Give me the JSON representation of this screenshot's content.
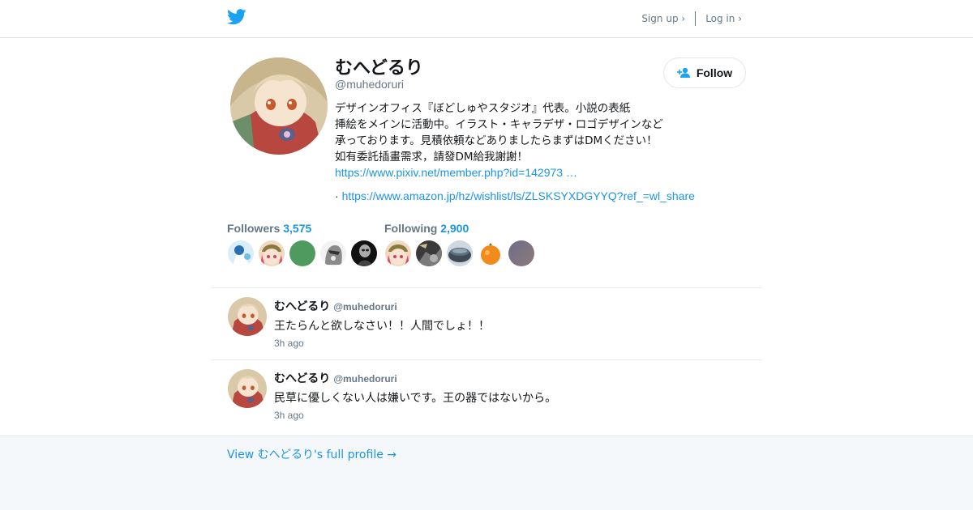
{
  "header": {
    "logo_icon": "twitter-bird-icon",
    "signup_label": "Sign up ›",
    "login_label": "Log in ›"
  },
  "profile": {
    "name": "むへどるり",
    "handle": "@muhedoruri",
    "follow_label": "Follow",
    "bio_lines": [
      "デザインオフィス『ぼどしゅやスタジオ』代表。小説の表紙",
      "挿絵をメインに活動中。イラスト・キャラデザ・ロゴデザインなど",
      "承っております。見積依頼などありましたらまずはDMください！",
      "如有委託插畫需求，請發DM給我謝謝！"
    ],
    "link1": "https://www.pixiv.net/member.php?id=142973 …",
    "link2_prefix": "·",
    "link2": "https://www.amazon.jp/hz/wishlist/ls/ZLSKSYXDGYYQ?ref_=wl_share"
  },
  "stats": {
    "followers_label": "Followers",
    "followers_count": "3,575",
    "following_label": "Following",
    "following_count": "2,900"
  },
  "tweets": [
    {
      "name": "むへどるり",
      "handle": "@muhedoruri",
      "text": "王たらんと欲しなさい！！人間でしょ！！",
      "time": "3h ago"
    },
    {
      "name": "むへどるり",
      "handle": "@muhedoruri",
      "text": "民草に優しくない人は嫌いです。王の器ではないから。",
      "time": "3h ago"
    }
  ],
  "footer": {
    "full_profile_link": "View むへどるり's full profile →"
  },
  "colors": {
    "brand": "#1da1f2",
    "link": "#1b95e0",
    "muted": "#657786"
  }
}
